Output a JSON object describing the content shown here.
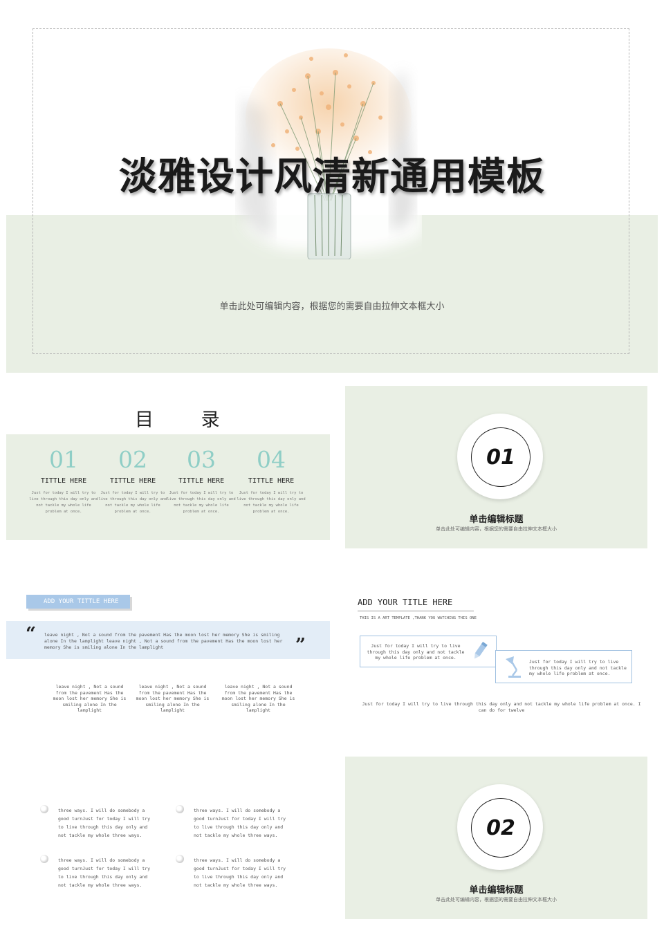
{
  "slide1": {
    "title": "淡雅设计风清新通用模板",
    "subtitle": "单击此处可编辑内容，根据您的需要自由拉伸文本框大小"
  },
  "slide2": {
    "title": "目 录",
    "items": [
      {
        "num": "01",
        "label": "TITTLE HERE",
        "desc": "Just for today I will try to live through this day only and not tackle my whole life problem at once."
      },
      {
        "num": "02",
        "label": "TITTLE HERE",
        "desc": "Just for today I will try to live through this day only and not tackle my whole life problem at once."
      },
      {
        "num": "03",
        "label": "TITTLE HERE",
        "desc": "Just for today I will try to live through this day only and not tackle my whole life problem at once."
      },
      {
        "num": "04",
        "label": "TITTLE HERE",
        "desc": "Just for today I will try to live through this day only and not tackle my whole life problem at once."
      }
    ]
  },
  "slide3": {
    "number": "01",
    "title": "单击编辑标题",
    "subtitle": "单击此处可编辑内容，根据您的需要自由拉伸文本框大小"
  },
  "slide4": {
    "tag": "ADD YOUR TITTLE HERE",
    "quote_open": "“",
    "quote_close": "”",
    "quote": "leave night , Not a sound from the pavement Has the moon lost her memory She is smiling alone In the lamplight  leave night , Not a sound from the pavement Has the moon lost her memory She is smiling alone In the lamplight",
    "columns": [
      "leave night , Not a sound from the pavement Has the moon lost her memory She is smiling alone In the lamplight",
      "leave night , Not a sound from the pavement Has the moon lost her memory She is smiling alone In the lamplight",
      "leave night , Not a sound from the pavement Has the moon lost her memory She is smiling alone In the lamplight"
    ]
  },
  "slide5": {
    "title": "ADD YOUR TITLE HERE",
    "subtitle": "THIS IS A ART TEMPLATE ,THANK YOU WATCHING THIS ONE",
    "box1": "Just for today I will try to live through this day only and not tackle my whole life problem at once.",
    "box2": "Just for today I will try to live through this day only and not tackle my whole life problem at once.",
    "bottom": "Just for today I will try to live through this day only and not tackle my whole life problem at once. I can do for twelve"
  },
  "slide6": {
    "bullets": [
      "three ways. I will do somebody a good turnJust for today I will try to live through this day only and not tackle my whole three ways.",
      "three ways. I will do somebody a good turnJust for today I will try to live through this day only and not tackle my whole three ways.",
      "three ways. I will do somebody a good turnJust for today I will try to live through this day only and not tackle my whole three ways.",
      "three ways. I will do somebody a good turnJust for today I will try to live through this day only and not tackle my whole three ways."
    ]
  },
  "slide7": {
    "number": "02",
    "title": "单击编辑标题",
    "subtitle": "单击此处可编辑内容，根据您的需要自由拉伸文本框大小"
  },
  "colors": {
    "green_band": "#e9efe4",
    "accent_teal": "#8fcec6",
    "accent_blue": "#a9c8e8",
    "quote_band": "#e3edf7"
  }
}
